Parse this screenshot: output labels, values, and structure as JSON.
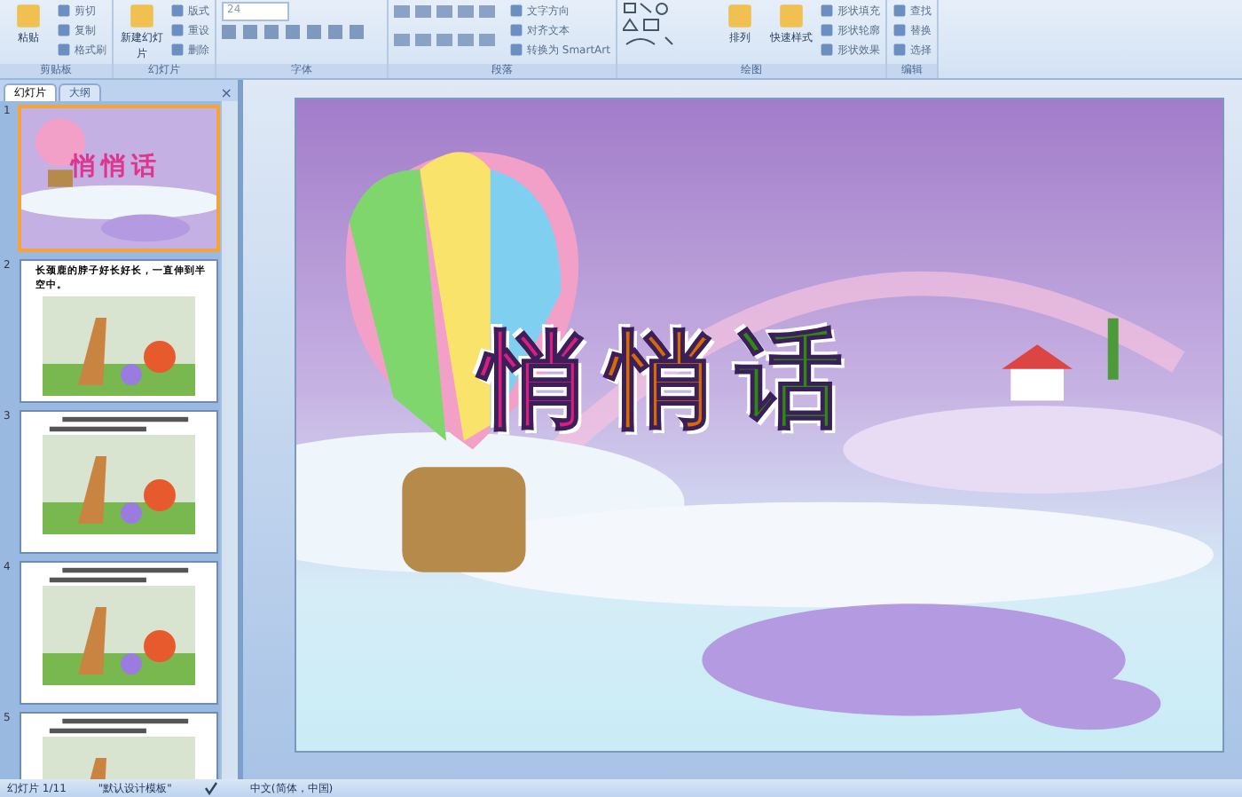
{
  "ribbon": {
    "groups": [
      {
        "kind": "clipboard",
        "label": "剪贴板",
        "items": [
          {
            "kind": "big",
            "label": "粘贴"
          },
          {
            "kind": "small",
            "label": "剪切"
          },
          {
            "kind": "small",
            "label": "复制"
          },
          {
            "kind": "small",
            "label": "格式刷"
          }
        ]
      },
      {
        "kind": "slides",
        "label": "幻灯片",
        "items": [
          {
            "kind": "big",
            "label": "新建幻灯片"
          },
          {
            "kind": "small",
            "label": "版式"
          },
          {
            "kind": "small",
            "label": "重设"
          },
          {
            "kind": "small",
            "label": "删除"
          }
        ]
      },
      {
        "kind": "font",
        "label": "字体",
        "items": [
          {
            "kind": "field",
            "label": "24"
          }
        ]
      },
      {
        "kind": "paragraph",
        "label": "段落",
        "items": [
          {
            "kind": "small",
            "label": "文字方向"
          },
          {
            "kind": "small",
            "label": "对齐文本"
          },
          {
            "kind": "small",
            "label": "转换为 SmartArt"
          }
        ]
      },
      {
        "kind": "drawing",
        "label": "绘图",
        "items": [
          {
            "kind": "big",
            "label": "排列"
          },
          {
            "kind": "big",
            "label": "快速样式"
          },
          {
            "kind": "small",
            "label": "形状填充"
          },
          {
            "kind": "small",
            "label": "形状轮廓"
          },
          {
            "kind": "small",
            "label": "形状效果"
          }
        ]
      },
      {
        "kind": "editing",
        "label": "编辑",
        "items": [
          {
            "kind": "small",
            "label": "查找"
          },
          {
            "kind": "small",
            "label": "替换"
          },
          {
            "kind": "small",
            "label": "选择"
          }
        ]
      }
    ]
  },
  "panel": {
    "tabs": [
      {
        "label": "幻灯片",
        "selected": true
      },
      {
        "label": "大纲",
        "selected": false
      }
    ],
    "close": "×"
  },
  "thumbnails": [
    {
      "number": "1",
      "kind": "title",
      "title": "悄悄话",
      "selected": true
    },
    {
      "number": "2",
      "kind": "story",
      "caption": "长颈鹿的脖子好长好长，一直伸到半空中。",
      "selected": false
    },
    {
      "number": "3",
      "kind": "story",
      "selected": false
    },
    {
      "number": "4",
      "kind": "story",
      "selected": false
    },
    {
      "number": "5",
      "kind": "story",
      "selected": false
    }
  ],
  "slide": {
    "title": "悄悄话"
  },
  "status_bar": {
    "slide": "幻灯片 1/11",
    "theme": "\"默认设计模板\"",
    "language": "中文(简体，中国)"
  }
}
